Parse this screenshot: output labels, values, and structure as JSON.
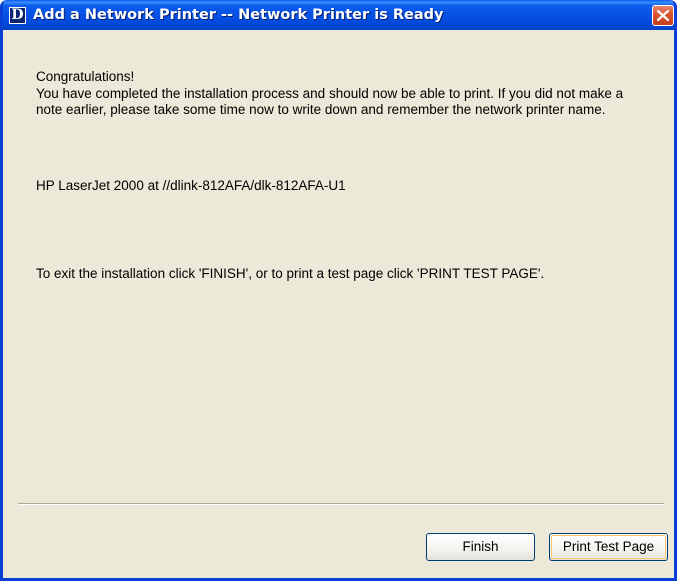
{
  "window": {
    "title": "Add a Network Printer -- Network Printer is Ready",
    "app_icon_glyph": "D",
    "close_icon": "close-icon"
  },
  "content": {
    "heading": "Congratulations!",
    "body": "You have completed the installation process and should now be able to print. If you did not make a note earlier, please take some time now to write down and remember the network printer name.",
    "printer_name": "HP LaserJet 2000 at //dlink-812AFA/dlk-812AFA-U1",
    "exit_instructions": "To exit the installation click 'FINISH', or to print a test page click 'PRINT TEST PAGE'."
  },
  "buttons": {
    "finish": "Finish",
    "print_test_page": "Print Test Page"
  },
  "colors": {
    "titlebar": "#0651e4",
    "dialog_background": "#ece9d8",
    "close_button": "#d9532e"
  }
}
